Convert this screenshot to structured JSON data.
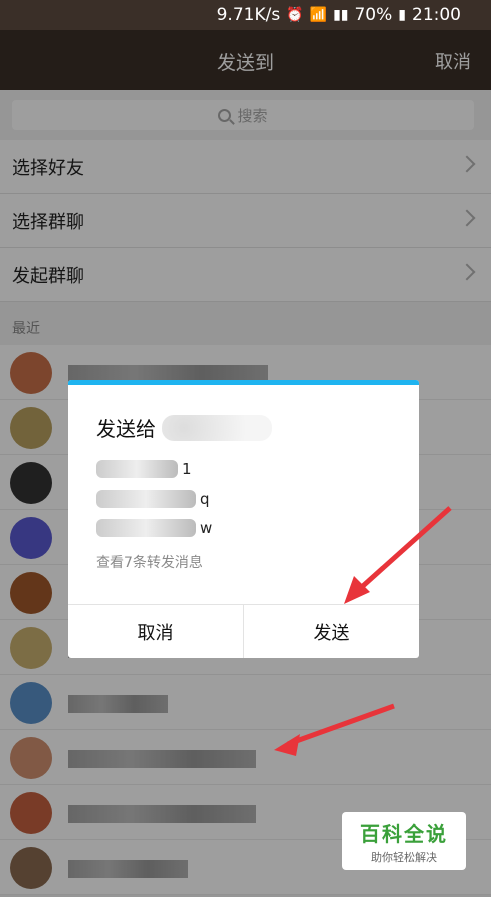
{
  "status_bar": {
    "speed": "9.71K/s",
    "battery": "70%",
    "time": "21:00"
  },
  "header": {
    "title": "发送到",
    "cancel": "取消"
  },
  "search": {
    "placeholder": "搜索"
  },
  "menu": [
    {
      "label": "选择好友"
    },
    {
      "label": "选择群聊"
    },
    {
      "label": "发起群聊"
    }
  ],
  "recent_label": "最近",
  "dialog": {
    "title_prefix": "发送给",
    "messages": [
      {
        "value": "1"
      },
      {
        "value": "q"
      },
      {
        "value": "w"
      }
    ],
    "view_more": "查看7条转发消息",
    "cancel": "取消",
    "send": "发送"
  },
  "watermark": {
    "main": "百科全说",
    "sub": "助你轻松解决"
  },
  "colors": {
    "accent": "#1fb4f0",
    "header_bg": "#3a2f28",
    "arrow": "#e8343a"
  }
}
